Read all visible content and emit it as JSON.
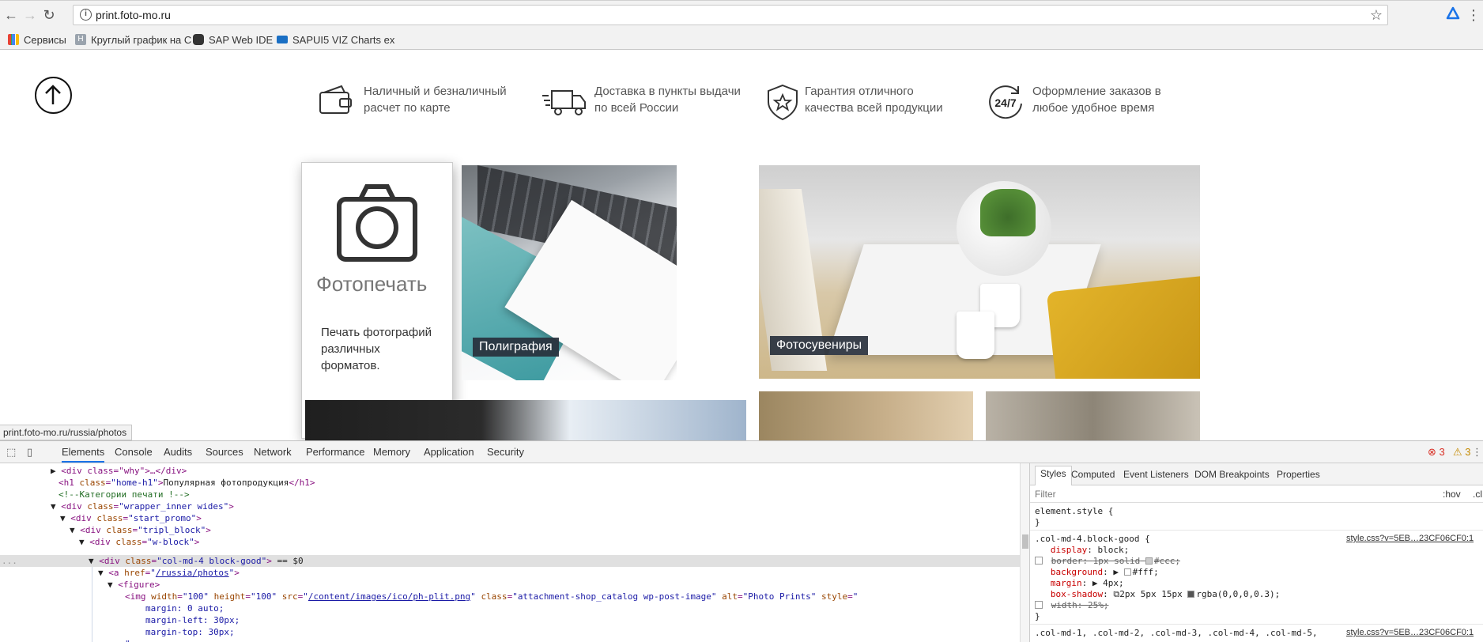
{
  "browser": {
    "url": "print.foto-mo.ru",
    "bookmarks": [
      "Сервисы",
      "Круглый график на С",
      "SAP Web IDE",
      "SAPUI5 VIZ Charts ex"
    ]
  },
  "features": [
    {
      "icon": "wallet-card-icon",
      "line1": "Наличный и безналичный",
      "line2": "расчет по карте"
    },
    {
      "icon": "delivery-truck-icon",
      "line1": "Доставка в пункты выдачи",
      "line2": "по всей России"
    },
    {
      "icon": "shield-star-icon",
      "line1": "Гарантия отличного",
      "line2": "качества всей продукции"
    },
    {
      "icon": "clock-24-7-icon",
      "line1": "Оформление заказов в",
      "line2": "любое удобное время"
    }
  ],
  "photo_card": {
    "title": "Фотопечать",
    "desc_lines": [
      "Печать фотографий",
      "различных",
      "форматов."
    ]
  },
  "captions": {
    "poligrafia": "Полиграфия",
    "fotosuveniry": "Фотосувениры"
  },
  "status_url": "print.foto-mo.ru/russia/photos",
  "devtools": {
    "tabs": [
      "Elements",
      "Console",
      "Audits",
      "Sources",
      "Network",
      "Performance",
      "Memory",
      "Application",
      "Security"
    ],
    "errors": "3",
    "warnings": "3",
    "side_tabs": [
      "Styles",
      "Computed",
      "Event Listeners",
      "DOM Breakpoints",
      "Properties"
    ],
    "filter_placeholder": "Filter",
    "hov": ":hov",
    ".cls": ".cl",
    "dom": {
      "l1": "<div class=\"why\">…</div>",
      "l2_tag": "h1",
      "l2_class": "home-h1",
      "l2_text": "Популярная фотопродукция",
      "l3": "<!--Категории печати !-->",
      "l4_class": "wrapper_inner wides",
      "l5_class": "start_promo",
      "l6_class": "tripl_block",
      "l7_class": "w-block",
      "l8_class": "col-md-4 block-good",
      "l8_suffix": " == $0",
      "l9_href": "/russia/photos",
      "l10": "<figure>",
      "l11_width": "100",
      "l11_height": "100",
      "l11_src": "/content/images/ico/ph-plit.png",
      "l11_class": "attachment-shop_catalog wp-post-image",
      "l11_alt": "Photo Prints",
      "l12": "margin: 0 auto;",
      "l13": "margin-left: 30px;",
      "l14": "margin-top: 30px;",
      "l15": "\">"
    },
    "styles": {
      "elem": "element.style {",
      "close": "}",
      "sel1": ".col-md-4.block-good {",
      "src1": "style.css?v=5EB…23CF06CF0:1",
      "props": [
        {
          "name": "display",
          "value": "block;",
          "strike": false,
          "cb": false
        },
        {
          "name": "border",
          "value": "1px solid",
          "swatch": "#cccccc",
          "swatch_label": "#ccc;",
          "strike": true,
          "cb": true
        },
        {
          "name": "background",
          "value": "",
          "swatch": "#ffffff",
          "swatch_label": "#fff;",
          "strike": false,
          "cb": false
        },
        {
          "name": "margin",
          "value": "4px;",
          "strike": false,
          "cb": false
        },
        {
          "name": "box-shadow",
          "value": "2px 5px 15px",
          "swatch": "#000000",
          "swatch_label": "rgba(0,0,0,0.3);",
          "strike": false,
          "cb": false
        },
        {
          "name": "width",
          "value": "25%;",
          "strike": true,
          "cb": true
        }
      ],
      "sel2": ".col-md-1, .col-md-2, .col-md-3, .col-md-4, .col-md-5,",
      "src2": "style.css?v=5EB…23CF06CF0:1"
    }
  }
}
